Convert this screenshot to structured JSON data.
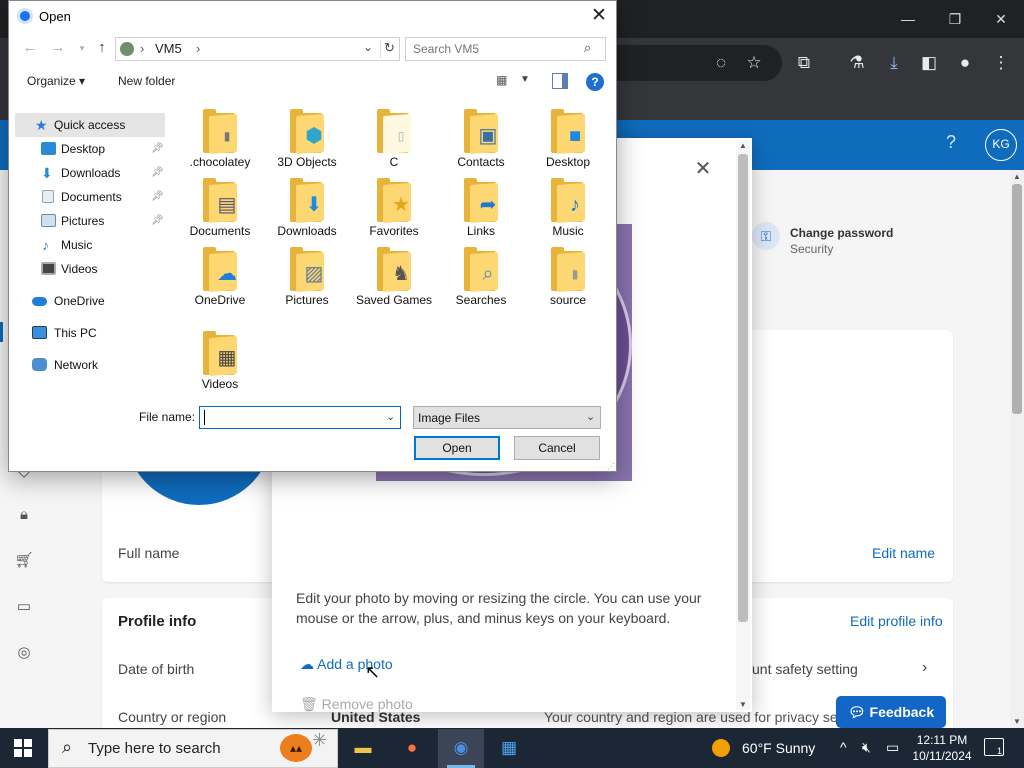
{
  "browser": {
    "win_controls": {
      "minimize": "—",
      "restore": "❐",
      "close": "✕"
    }
  },
  "site": {
    "help": "?",
    "avatar_initials": "KG",
    "change_password": {
      "title": "Change password",
      "subtitle": "Security"
    },
    "profile": {
      "full_name_label": "Full name",
      "edit_name": "Edit name"
    },
    "profile_info": {
      "title": "Profile info",
      "edit": "Edit profile info",
      "date_of_birth_label": "Date of birth",
      "safety_setting": "unt safety setting",
      "country_label": "Country or region",
      "country_value": "United States",
      "privacy_text": "Your country and region are used for privacy se"
    },
    "feedback": "Feedback"
  },
  "photo_modal": {
    "close": "✕",
    "description": "Edit your photo by moving or resizing the circle. You can use your mouse or the arrow, plus, and minus keys on your keyboard.",
    "add_photo": "Add a photo",
    "remove_photo": "Remove photo"
  },
  "open_dialog": {
    "title": "Open",
    "close": "✕",
    "address": {
      "path": "VM5",
      "separator": "›"
    },
    "search_placeholder": "Search VM5",
    "toolbar": {
      "organize": "Organize ▾",
      "new_folder": "New folder",
      "help": "?"
    },
    "nav": [
      {
        "label": "Quick access",
        "selected": true
      },
      {
        "label": "Desktop",
        "pinned": true
      },
      {
        "label": "Downloads",
        "pinned": true
      },
      {
        "label": "Documents",
        "pinned": true
      },
      {
        "label": "Pictures",
        "pinned": true
      },
      {
        "label": "Music"
      },
      {
        "label": "Videos"
      },
      {
        "label": "OneDrive"
      },
      {
        "label": "This PC"
      },
      {
        "label": "Network"
      }
    ],
    "files": [
      ".chocolatey",
      "3D Objects",
      "C",
      "Contacts",
      "Desktop",
      "Documents",
      "Downloads",
      "Favorites",
      "Links",
      "Music",
      "OneDrive",
      "Pictures",
      "Saved Games",
      "Searches",
      "source",
      "Videos"
    ],
    "file_name_label": "File name:",
    "file_name_value": "",
    "file_type": "Image Files",
    "open_button": "Open",
    "cancel_button": "Cancel"
  },
  "taskbar": {
    "search_placeholder": "Type here to search",
    "weather": "60°F  Sunny",
    "time": "12:11 PM",
    "date": "10/11/2024",
    "notification_count": "1"
  },
  "colors": {
    "accent": "#0f6cbd",
    "folder": "#fcd772",
    "taskbar": "#1c2736"
  }
}
